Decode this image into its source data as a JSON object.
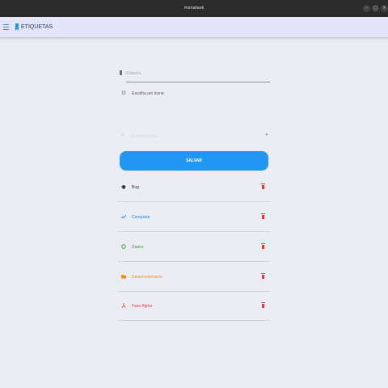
{
  "window": {
    "title": "monatask"
  },
  "appbar": {
    "title": "ETIQUETAS"
  },
  "form": {
    "label_placeholder": "Etiqueta",
    "icon_picker": "Escolha um ícone",
    "dropdown_value": "Modelo padrão",
    "save_label": "SALVAR"
  },
  "tags": [
    {
      "label": "Bug",
      "color": "#333333",
      "icon": "bug-icon"
    },
    {
      "label": "Conquiste",
      "color": "#1E88E5",
      "icon": "trending-up-icon"
    },
    {
      "label": "Dados",
      "color": "#43A047",
      "icon": "circle-icon"
    },
    {
      "label": "Desenvolvimento",
      "color": "#FB8C00",
      "icon": "folder-icon"
    },
    {
      "label": "Fase Alpha",
      "color": "#E53935",
      "icon": "fork-icon"
    }
  ],
  "colors": {
    "accent": "#2196F3",
    "delete": "#E53935"
  }
}
